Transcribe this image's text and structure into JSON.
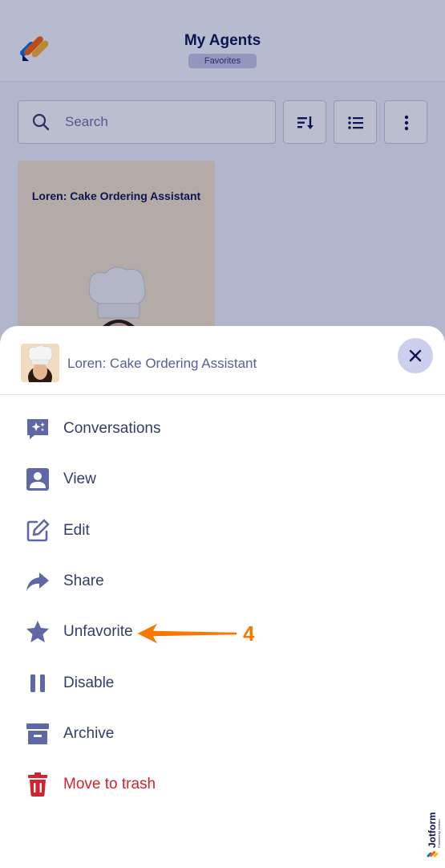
{
  "app": {
    "title": "My Agents",
    "subtitle": "Favorites",
    "search_placeholder": "Search",
    "card_title": "Loren: Cake Ordering Assistant"
  },
  "sheet": {
    "title": "Loren: Cake Ordering Assistant",
    "items": [
      {
        "label": "Conversations",
        "icon": "conversations-icon"
      },
      {
        "label": "View",
        "icon": "person-icon"
      },
      {
        "label": "Edit",
        "icon": "edit-icon"
      },
      {
        "label": "Share",
        "icon": "share-icon"
      },
      {
        "label": "Unfavorite",
        "icon": "star-icon"
      },
      {
        "label": "Disable",
        "icon": "pause-icon"
      },
      {
        "label": "Archive",
        "icon": "archive-icon"
      },
      {
        "label": "Move to trash",
        "icon": "trash-icon"
      }
    ]
  },
  "annotation": {
    "number": "4"
  },
  "watermark": {
    "brand": "Jotform",
    "tagline": "Powered by Jotform"
  },
  "colors": {
    "navy": "#0a1551",
    "icon": "#5f67a6",
    "label": "#343c6a",
    "danger": "#d3232f",
    "accent_orange": "#f77800"
  }
}
